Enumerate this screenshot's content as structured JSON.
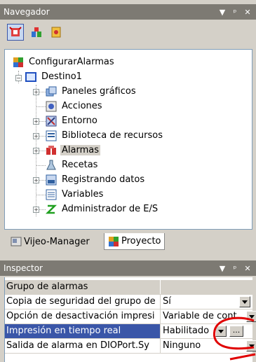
{
  "navigator": {
    "title": "Navegador",
    "toolbar": [
      "alarm-icon",
      "project-tree-icon",
      "resources-icon"
    ],
    "tree": {
      "root": "ConfigurarAlarmas",
      "target": "Destino1",
      "items": [
        {
          "label": "Paneles gráficos",
          "expandable": true
        },
        {
          "label": "Acciones",
          "expandable": false
        },
        {
          "label": "Entorno",
          "expandable": true
        },
        {
          "label": "Biblioteca de recursos",
          "expandable": true
        },
        {
          "label": "Alarmas",
          "expandable": true,
          "selected": true
        },
        {
          "label": "Recetas",
          "expandable": false
        },
        {
          "label": "Registrando datos",
          "expandable": true
        },
        {
          "label": "Variables",
          "expandable": false
        },
        {
          "label": "Administrador de E/S",
          "expandable": true
        }
      ]
    },
    "tabs": [
      {
        "label": "Vijeo-Manager",
        "active": false
      },
      {
        "label": "Proyecto",
        "active": true
      }
    ]
  },
  "inspector": {
    "title": "Inspector",
    "group_header": "Grupo de alarmas",
    "rows": [
      {
        "name": "Copia de seguridad del grupo de",
        "value": "Sí",
        "dropdown": true
      },
      {
        "name": "Opción de desactivación impresi",
        "value": "Variable de cont",
        "dropdown": true
      },
      {
        "name": "Impresión en tiempo real",
        "value": "Habilitado",
        "dropdown": true,
        "ellipsis": true,
        "selected": true
      },
      {
        "name": "Salida de alarma en DIOPort.Sy",
        "value": "Ninguno",
        "dropdown": true
      }
    ],
    "ellipsis_label": "..."
  },
  "colors": {
    "title_bar": "#7d7a73",
    "selection": "#3a56a8",
    "annotation": "#e00000"
  }
}
